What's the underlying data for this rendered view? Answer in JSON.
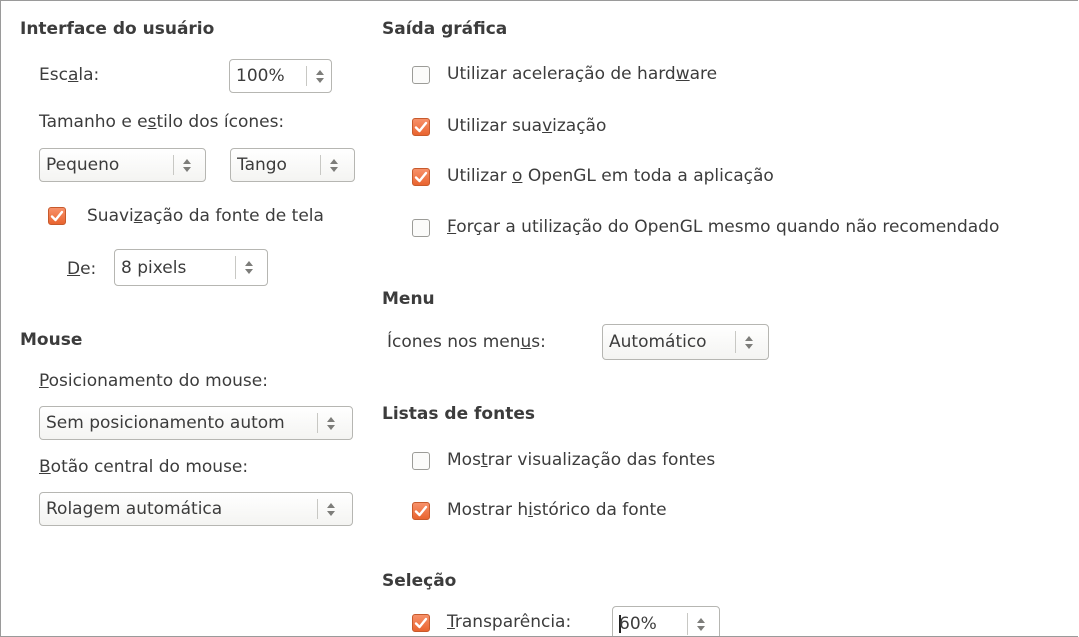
{
  "ui": {
    "heading": "Interface do usuário",
    "scale_label": "Escala:",
    "scale_value": "100%",
    "icon_size_label": "Tamanho e estilo dos ícones:",
    "icon_size_value": "Pequeno",
    "icon_style_value": "Tango",
    "font_smoothing_label": "Suavização da fonte de tela",
    "font_smoothing_checked": true,
    "from_label": "De:",
    "from_value": "8 pixels"
  },
  "mouse": {
    "heading": "Mouse",
    "positioning_label": "Posicionamento do mouse:",
    "positioning_value": "Sem posicionamento autom",
    "middle_button_label": "Botão central do mouse:",
    "middle_button_value": "Rolagem automática"
  },
  "graphics": {
    "heading": "Saída gráfica",
    "hw_accel_label": "Utilizar aceleração de hardware",
    "hw_accel_checked": false,
    "antialias_label": "Utilizar suavização",
    "antialias_checked": true,
    "opengl_label": "Utilizar o OpenGL em toda a aplicação",
    "opengl_checked": true,
    "force_opengl_label": "Forçar a utilização do OpenGL mesmo quando não recomendado",
    "force_opengl_checked": false
  },
  "menu": {
    "heading": "Menu",
    "icons_label": "Ícones nos menus:",
    "icons_value": "Automático"
  },
  "font_lists": {
    "heading": "Listas de fontes",
    "preview_label": "Mostrar visualização das fontes",
    "preview_checked": false,
    "history_label": "Mostrar histórico da fonte",
    "history_checked": true
  },
  "selection": {
    "heading": "Seleção",
    "transparency_label": "Transparência:",
    "transparency_checked": true,
    "transparency_value": "60%"
  },
  "colors": {
    "accent": "#e9642f",
    "text": "#3c3c3c",
    "border": "#b6b6b2"
  },
  "icons": [
    "checkmark-icon",
    "spin-up-icon",
    "spin-down-icon"
  ]
}
